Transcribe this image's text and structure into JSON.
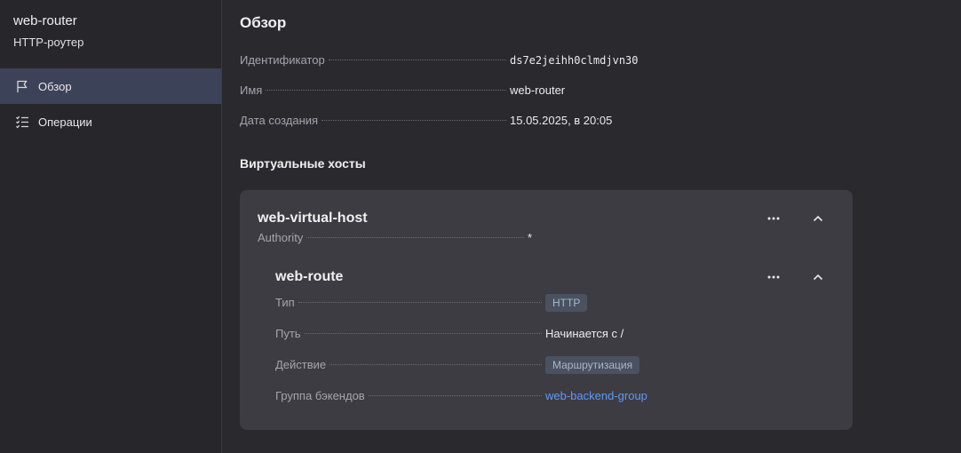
{
  "sidebar": {
    "title": "web-router",
    "subtitle": "HTTP-роутер",
    "items": [
      {
        "label": "Обзор",
        "icon": "flag-icon",
        "active": true
      },
      {
        "label": "Операции",
        "icon": "checklist-icon",
        "active": false
      }
    ]
  },
  "overview": {
    "heading": "Обзор",
    "id_label": "Идентификатор",
    "id_value": "ds7e2jeihh0clmdjvn30",
    "name_label": "Имя",
    "name_value": "web-router",
    "created_label": "Дата создания",
    "created_value": "15.05.2025, в 20:05"
  },
  "vhosts": {
    "heading": "Виртуальные хосты",
    "host": {
      "name": "web-virtual-host",
      "authority_label": "Authority",
      "authority_value": "*",
      "more_icon": "more-horizontal-icon",
      "collapse_icon": "chevron-up-icon",
      "route": {
        "name": "web-route",
        "type_label": "Тип",
        "type_value": "HTTP",
        "path_label": "Путь",
        "path_value": "Начинается с /",
        "action_label": "Действие",
        "action_value": "Маршрутизация",
        "backend_label": "Группа бэкендов",
        "backend_value": "web-backend-group"
      }
    }
  },
  "colors": {
    "background": "#2a292e",
    "sidebar_active": "#3c4257",
    "card": "#3d3c42",
    "link": "#5b9bf7",
    "badge_bg": "#4a5160"
  }
}
